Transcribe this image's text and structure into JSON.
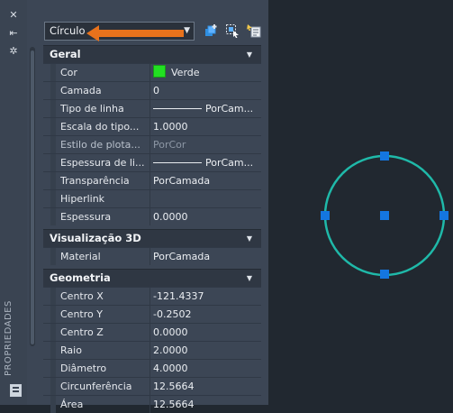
{
  "side_strip": {
    "title": "PROPRIEDADES"
  },
  "selector": {
    "value": "Círculo"
  },
  "categories": [
    {
      "title": "Geral",
      "rows": [
        {
          "name": "Cor",
          "value": "Verde"
        },
        {
          "name": "Camada",
          "value": "0"
        },
        {
          "name": "Tipo de linha",
          "value": "PorCam..."
        },
        {
          "name": "Escala do tipo...",
          "value": "1.0000"
        },
        {
          "name": "Estilo de plota...",
          "value": "PorCor"
        },
        {
          "name": "Espessura de li...",
          "value": "PorCam..."
        },
        {
          "name": "Transparência",
          "value": "PorCamada"
        },
        {
          "name": "Hiperlink",
          "value": ""
        },
        {
          "name": "Espessura",
          "value": "0.0000"
        }
      ]
    },
    {
      "title": "Visualização 3D",
      "rows": [
        {
          "name": "Material",
          "value": "PorCamada"
        }
      ]
    },
    {
      "title": "Geometria",
      "rows": [
        {
          "name": "Centro X",
          "value": "-121.4337"
        },
        {
          "name": "Centro Y",
          "value": "-0.2502"
        },
        {
          "name": "Centro Z",
          "value": "0.0000"
        },
        {
          "name": "Raio",
          "value": "2.0000"
        },
        {
          "name": "Diâmetro",
          "value": "4.0000"
        },
        {
          "name": "Circunferência",
          "value": "12.5664"
        },
        {
          "name": "Área",
          "value": "12.5664"
        }
      ]
    }
  ],
  "colors": {
    "color_swatch": "#22e022",
    "circle": "#1fb9a9",
    "grip": "#1476e0",
    "arrow": "#e8721c"
  }
}
